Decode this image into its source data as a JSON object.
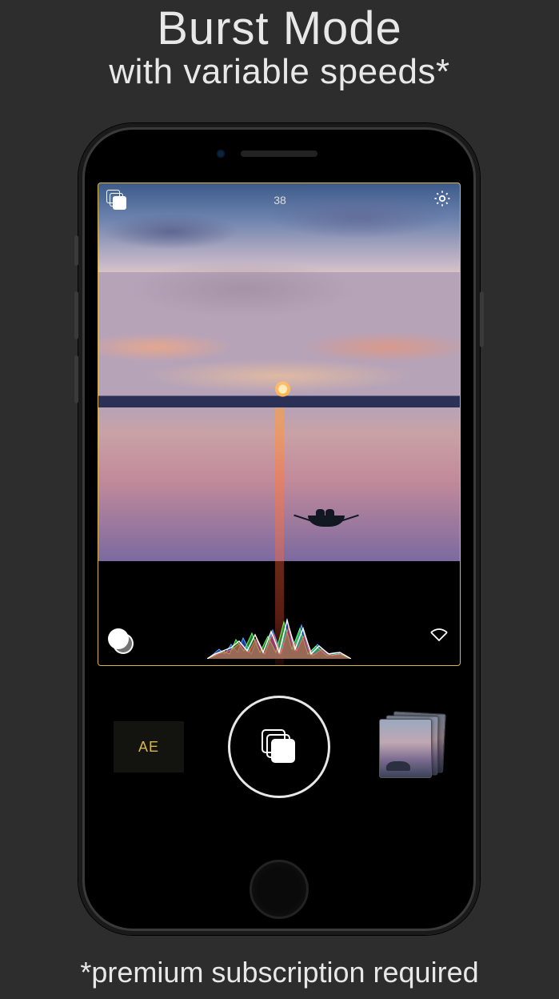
{
  "promo": {
    "title": "Burst Mode",
    "subtitle": "with variable speeds*",
    "footnote": "*premium subscription required"
  },
  "viewfinder": {
    "counter": "38"
  },
  "controls": {
    "ae_label": "AE"
  },
  "icons": {
    "burst": "burst-icon",
    "settings": "gear-icon",
    "filters": "filters-icon",
    "histogram": "histogram-icon",
    "vignette": "vignette-icon"
  }
}
